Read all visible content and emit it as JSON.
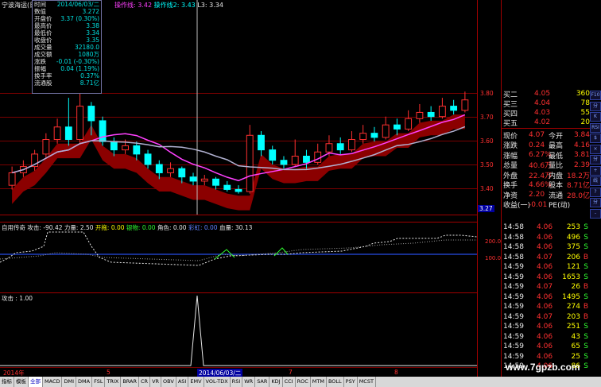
{
  "header": {
    "title": "宁波海运(日",
    "mid_label": "操作线",
    "mid_value": "3.42",
    "mid2_label": "操作线2",
    "mid2_value": "3.43",
    "l3_label": "L3",
    "l3_value": "3.34"
  },
  "tooltip": {
    "top_label": "时间",
    "top_value": "2014/06/03/二",
    "rows": [
      {
        "label": "数值",
        "value": "3.272"
      },
      {
        "label": "开盘价",
        "value": "3.37 (0.30%)"
      },
      {
        "label": "最高价",
        "value": "3.38"
      },
      {
        "label": "最低价",
        "value": "3.34"
      },
      {
        "label": "收盘价",
        "value": "3.35"
      },
      {
        "label": "成交量",
        "value": "32180.0"
      },
      {
        "label": "成交额",
        "value": "1080万"
      },
      {
        "label": "涨跌",
        "value": "-0.01 (-0.30%)"
      },
      {
        "label": "振幅",
        "value": "0.04 (1.19%)"
      },
      {
        "label": "换手率",
        "value": "0.37%"
      },
      {
        "label": "流通股",
        "value": "8.71亿"
      }
    ]
  },
  "price_axis": {
    "labels": [
      "3.80",
      "3.70",
      "3.60",
      "3.50",
      "3.40"
    ],
    "current": "3.27"
  },
  "order_book": [
    {
      "label": "买二",
      "price": "4.05",
      "vol": "360"
    },
    {
      "label": "买三",
      "price": "4.04",
      "vol": "78"
    },
    {
      "label": "买四",
      "price": "4.03",
      "vol": "55"
    },
    {
      "label": "买五",
      "price": "4.02",
      "vol": "20"
    }
  ],
  "quote": [
    {
      "l1": "现价",
      "v1": "4.07",
      "l2": "今开",
      "v2": "3.84"
    },
    {
      "l1": "涨跌",
      "v1": "0.24",
      "l2": "最高",
      "v2": "4.16"
    },
    {
      "l1": "涨幅",
      "v1": "6.27%",
      "l2": "最低",
      "v2": "3.81"
    },
    {
      "l1": "总量",
      "v1": "40.6万",
      "l2": "量比",
      "v2": "2.39"
    },
    {
      "l1": "外盘",
      "v1": "22.4万",
      "l2": "内盘",
      "v2": "18.2万"
    },
    {
      "l1": "换手",
      "v1": "4.66%",
      "l2": "股本",
      "v2": "8.71亿"
    },
    {
      "l1": "净资",
      "v1": "2.20",
      "l2": "流通",
      "v2": "28.0亿"
    },
    {
      "l1": "收益(一)",
      "v1": "-0.01",
      "l2": "PE(动)",
      "v2": ""
    }
  ],
  "ticks": [
    {
      "time": "14:58",
      "price": "4.06",
      "vol": "253",
      "side": "S"
    },
    {
      "time": "14:58",
      "price": "4.06",
      "vol": "496",
      "side": "S"
    },
    {
      "time": "14:58",
      "price": "4.06",
      "vol": "375",
      "side": "S"
    },
    {
      "time": "14:58",
      "price": "4.07",
      "vol": "206",
      "side": "B"
    },
    {
      "time": "14:59",
      "price": "4.06",
      "vol": "121",
      "side": "S"
    },
    {
      "time": "14:59",
      "price": "4.06",
      "vol": "1653",
      "side": "S"
    },
    {
      "time": "14:59",
      "price": "4.07",
      "vol": "26",
      "side": "B"
    },
    {
      "time": "14:59",
      "price": "4.06",
      "vol": "1495",
      "side": "S"
    },
    {
      "time": "14:59",
      "price": "4.06",
      "vol": "274",
      "side": "B"
    },
    {
      "time": "14:59",
      "price": "4.07",
      "vol": "203",
      "side": "B"
    },
    {
      "time": "14:59",
      "price": "4.06",
      "vol": "251",
      "side": "S"
    },
    {
      "time": "14:59",
      "price": "4.06",
      "vol": "43",
      "side": "S"
    },
    {
      "time": "14:59",
      "price": "4.06",
      "vol": "65",
      "side": "S"
    },
    {
      "time": "14:59",
      "price": "4.06",
      "vol": "25",
      "side": "S"
    },
    {
      "time": "14:59",
      "price": "4.06",
      "vol": "86",
      "side": "S"
    }
  ],
  "indicator1": {
    "name": "自用传奇",
    "items": [
      {
        "label": "攻击",
        "value": "-90.42",
        "color": "#e8e8e8"
      },
      {
        "label": "力量",
        "value": "2.50",
        "color": "#e8e8e8"
      },
      {
        "label": "开拖",
        "value": "0.00",
        "color": "#ffff00"
      },
      {
        "label": "银物",
        "value": "0.00",
        "color": "#30ff30"
      },
      {
        "label": "角色",
        "value": "0.00",
        "color": "#e8e8e8"
      },
      {
        "label": "彩虹",
        "value": "0.00",
        "color": "#6080ff"
      },
      {
        "label": "血量",
        "value": "30.13",
        "color": "#e8e8e8"
      }
    ],
    "axis": [
      "200.0",
      "100.0"
    ]
  },
  "indicator2": {
    "label": "攻击",
    "value": "1.00"
  },
  "date_axis": {
    "start": "2014年",
    "marks": [
      "5",
      "7",
      "8"
    ],
    "cursor": "2014/06/03/二"
  },
  "tabs": [
    "指标",
    "模板",
    "全部",
    "MACD",
    "DMI",
    "DMA",
    "FSL",
    "TRIX",
    "BRAR",
    "CR",
    "VR",
    "OBV",
    "ASI",
    "EMV",
    "VOL-TDX",
    "RSI",
    "WR",
    "SAR",
    "KDJ",
    "CCI",
    "ROC",
    "MTM",
    "BOLL",
    "PSY",
    "MCST"
  ],
  "sidebar_icons": [
    "F10",
    "分",
    "K",
    "RSI",
    "$",
    "×",
    "分",
    "+",
    "线",
    "?",
    "分",
    "-"
  ],
  "watermark": "www.7gpzb.com",
  "colors": {
    "up": "#ff3030",
    "down": "#00ffff",
    "grid": "#7a0000",
    "band": "#8b0000"
  },
  "chart_data": {
    "type": "candlestick",
    "ylim": [
      3.27,
      3.85
    ],
    "candles": [
      {
        "o": 3.38,
        "c": 3.44,
        "h": 3.47,
        "l": 3.36
      },
      {
        "o": 3.44,
        "c": 3.47,
        "h": 3.5,
        "l": 3.42
      },
      {
        "o": 3.47,
        "c": 3.53,
        "h": 3.55,
        "l": 3.45
      },
      {
        "o": 3.53,
        "c": 3.6,
        "h": 3.63,
        "l": 3.51
      },
      {
        "o": 3.6,
        "c": 3.66,
        "h": 3.7,
        "l": 3.58
      },
      {
        "o": 3.66,
        "c": 3.6,
        "h": 3.8,
        "l": 3.57
      },
      {
        "o": 3.6,
        "c": 3.76,
        "h": 3.82,
        "l": 3.58
      },
      {
        "o": 3.76,
        "c": 3.69,
        "h": 3.78,
        "l": 3.62
      },
      {
        "o": 3.69,
        "c": 3.59,
        "h": 3.71,
        "l": 3.57
      },
      {
        "o": 3.59,
        "c": 3.55,
        "h": 3.61,
        "l": 3.52
      },
      {
        "o": 3.55,
        "c": 3.57,
        "h": 3.6,
        "l": 3.53
      },
      {
        "o": 3.57,
        "c": 3.53,
        "h": 3.59,
        "l": 3.5
      },
      {
        "o": 3.53,
        "c": 3.48,
        "h": 3.55,
        "l": 3.46
      },
      {
        "o": 3.48,
        "c": 3.44,
        "h": 3.5,
        "l": 3.41
      },
      {
        "o": 3.44,
        "c": 3.46,
        "h": 3.49,
        "l": 3.42
      },
      {
        "o": 3.46,
        "c": 3.42,
        "h": 3.47,
        "l": 3.39
      },
      {
        "o": 3.42,
        "c": 3.4,
        "h": 3.44,
        "l": 3.38
      },
      {
        "o": 3.4,
        "c": 3.41,
        "h": 3.43,
        "l": 3.38
      },
      {
        "o": 3.41,
        "c": 3.38,
        "h": 3.42,
        "l": 3.36
      },
      {
        "o": 3.38,
        "c": 3.36,
        "h": 3.4,
        "l": 3.35
      },
      {
        "o": 3.36,
        "c": 3.35,
        "h": 3.38,
        "l": 3.34
      },
      {
        "o": 3.35,
        "c": 3.62,
        "h": 3.67,
        "l": 3.34
      },
      {
        "o": 3.62,
        "c": 3.55,
        "h": 3.64,
        "l": 3.52
      },
      {
        "o": 3.55,
        "c": 3.5,
        "h": 3.57,
        "l": 3.48
      },
      {
        "o": 3.5,
        "c": 3.48,
        "h": 3.52,
        "l": 3.46
      },
      {
        "o": 3.48,
        "c": 3.52,
        "h": 3.6,
        "l": 3.47
      },
      {
        "o": 3.52,
        "c": 3.49,
        "h": 3.55,
        "l": 3.46
      },
      {
        "o": 3.49,
        "c": 3.54,
        "h": 3.58,
        "l": 3.48
      },
      {
        "o": 3.54,
        "c": 3.58,
        "h": 3.62,
        "l": 3.52
      },
      {
        "o": 3.58,
        "c": 3.55,
        "h": 3.61,
        "l": 3.53
      },
      {
        "o": 3.55,
        "c": 3.6,
        "h": 3.64,
        "l": 3.54
      },
      {
        "o": 3.6,
        "c": 3.63,
        "h": 3.67,
        "l": 3.58
      },
      {
        "o": 3.63,
        "c": 3.61,
        "h": 3.66,
        "l": 3.59
      },
      {
        "o": 3.61,
        "c": 3.67,
        "h": 3.71,
        "l": 3.6
      },
      {
        "o": 3.67,
        "c": 3.65,
        "h": 3.7,
        "l": 3.62
      },
      {
        "o": 3.65,
        "c": 3.7,
        "h": 3.74,
        "l": 3.64
      },
      {
        "o": 3.7,
        "c": 3.73,
        "h": 3.77,
        "l": 3.68
      },
      {
        "o": 3.73,
        "c": 3.71,
        "h": 3.76,
        "l": 3.69
      },
      {
        "o": 3.71,
        "c": 3.76,
        "h": 3.8,
        "l": 3.7
      },
      {
        "o": 3.76,
        "c": 3.74,
        "h": 3.79,
        "l": 3.72
      },
      {
        "o": 3.74,
        "c": 3.79,
        "h": 3.83,
        "l": 3.73
      }
    ]
  }
}
